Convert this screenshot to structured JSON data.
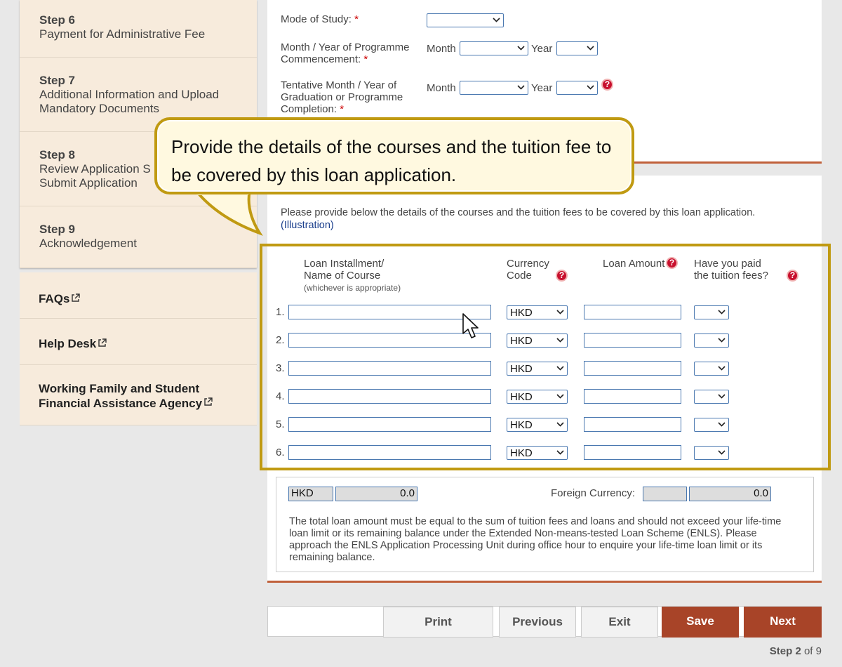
{
  "sidebar": {
    "steps": [
      {
        "num": "Step 6",
        "title": "Payment for Administrative Fee"
      },
      {
        "num": "Step 7",
        "title": "Additional Information and Upload Mandatory Documents"
      },
      {
        "num": "Step 8",
        "title": "Review Application Summary and Submit Application"
      },
      {
        "num": "Step 9",
        "title": "Acknowledgement"
      }
    ],
    "step8_line1": "Review Application S",
    "step8_line2": "Submit Application",
    "step7_line1": "Additional Information and Upload",
    "step7_line2": "Mandatory Documents",
    "links": [
      {
        "label": "FAQs"
      },
      {
        "label": "Help Desk"
      },
      {
        "label_line1": "Working Family and Student",
        "label_line2": "Financial Assistance Agency"
      }
    ]
  },
  "top_form": {
    "mode_label": "Mode of Study:",
    "commence_label_1": "Month / Year of Programme",
    "commence_label_2": "Commencement:",
    "grad_label_1": "Tentative Month / Year of",
    "grad_label_2": "Graduation or Programme",
    "grad_label_3": "Completion:",
    "required_mark": "*",
    "month_word": "Month",
    "year_word": "Year"
  },
  "course_section": {
    "intro": "Please provide below the details of the courses and the tuition fees to be covered by this loan application.",
    "illustration_link": "(Illustration)",
    "col_name_1": "Loan Installment/",
    "col_name_2": "Name of Course",
    "col_name_note": "(whichever is appropriate)",
    "col_currency_1": "Currency",
    "col_currency_2": "Code",
    "col_amount": "Loan Amount",
    "col_paid_1": "Have you paid",
    "col_paid_2": "the tuition fees?",
    "rows": [
      {
        "num": "1.",
        "currency": "HKD"
      },
      {
        "num": "2.",
        "currency": "HKD"
      },
      {
        "num": "3.",
        "currency": "HKD"
      },
      {
        "num": "4.",
        "currency": "HKD"
      },
      {
        "num": "5.",
        "currency": "HKD"
      },
      {
        "num": "6.",
        "currency": "HKD"
      }
    ],
    "help_glyph": "?"
  },
  "totals": {
    "hkd_label": "HKD",
    "hkd_total": "0.0",
    "foreign_label": "Foreign Currency:",
    "foreign_total": "0.0",
    "note": "The total loan amount must be equal to the sum of tuition fees and loans and should not exceed your life-time loan limit or its remaining balance under the Extended Non-means-tested Loan Scheme (ENLS). Please approach the ENLS Application Processing Unit during office hour to enquire your life-time loan limit or its remaining balance."
  },
  "buttons": {
    "print": "Print",
    "previous": "Previous",
    "exit": "Exit",
    "save": "Save",
    "next": "Next"
  },
  "step_indicator": {
    "current": "Step 2",
    "of": "of 9"
  },
  "callout": {
    "text": "Provide the details of the courses and the tuition fee to be covered by this loan application."
  },
  "colors": {
    "accent": "#c0603a",
    "button_red": "#a84428",
    "highlight": "#c09a12",
    "sidebar_bg": "#f7ebdc"
  }
}
